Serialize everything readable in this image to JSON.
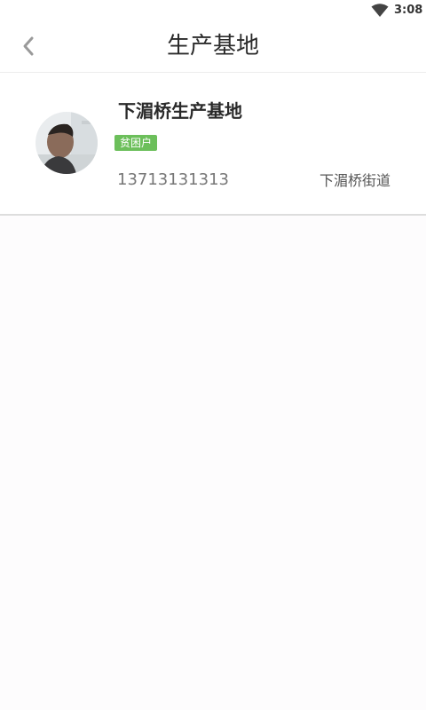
{
  "status_bar": {
    "time": "3:08",
    "wifi_icon": "wifi-icon"
  },
  "header": {
    "title": "生产基地",
    "back_icon": "chevron-left-icon"
  },
  "base_card": {
    "name": "下湄桥生产基地",
    "tag": "贫困户",
    "tag_color": "#6cbf5b",
    "phone": "13713131313",
    "street": "下湄桥街道"
  }
}
